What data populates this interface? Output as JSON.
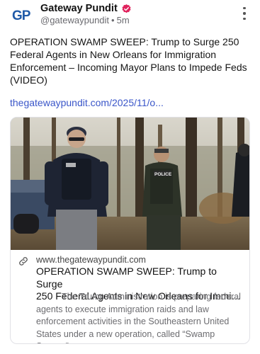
{
  "account": {
    "avatar_text": "GP",
    "display_name": "Gateway Pundit",
    "handle": "@gatewaypundit",
    "separator": "•",
    "time": "5m",
    "verified_color": "#e0245e"
  },
  "post": {
    "text": "OPERATION SWAMP SWEEP: Trump to Surge 250 Federal Agents in New Orleans for Immigration Enforcement – Incoming Mayor Plans to Impede Feds (VIDEO)",
    "link": "thegatewaypundit.com/2025/11/o...",
    "link_color": "#3a56c9"
  },
  "card": {
    "image_badge": "POLICE",
    "domain": "www.thegatewaypundit.com",
    "title_line1": "OPERATION SWAMP SWEEP: Trump to Surge",
    "title_line2": "250 Federal Agents in New Orleans for Immigr...",
    "description": "The Trump Administration is preparing federal agents to execute immigration raids and law enforcement activities in the Southeastern United States under a new operation, called “Swamp Sweep.”..."
  },
  "icons": {
    "menu": "more-vertical-icon",
    "verified": "verified-badge-icon",
    "link": "link-icon"
  }
}
